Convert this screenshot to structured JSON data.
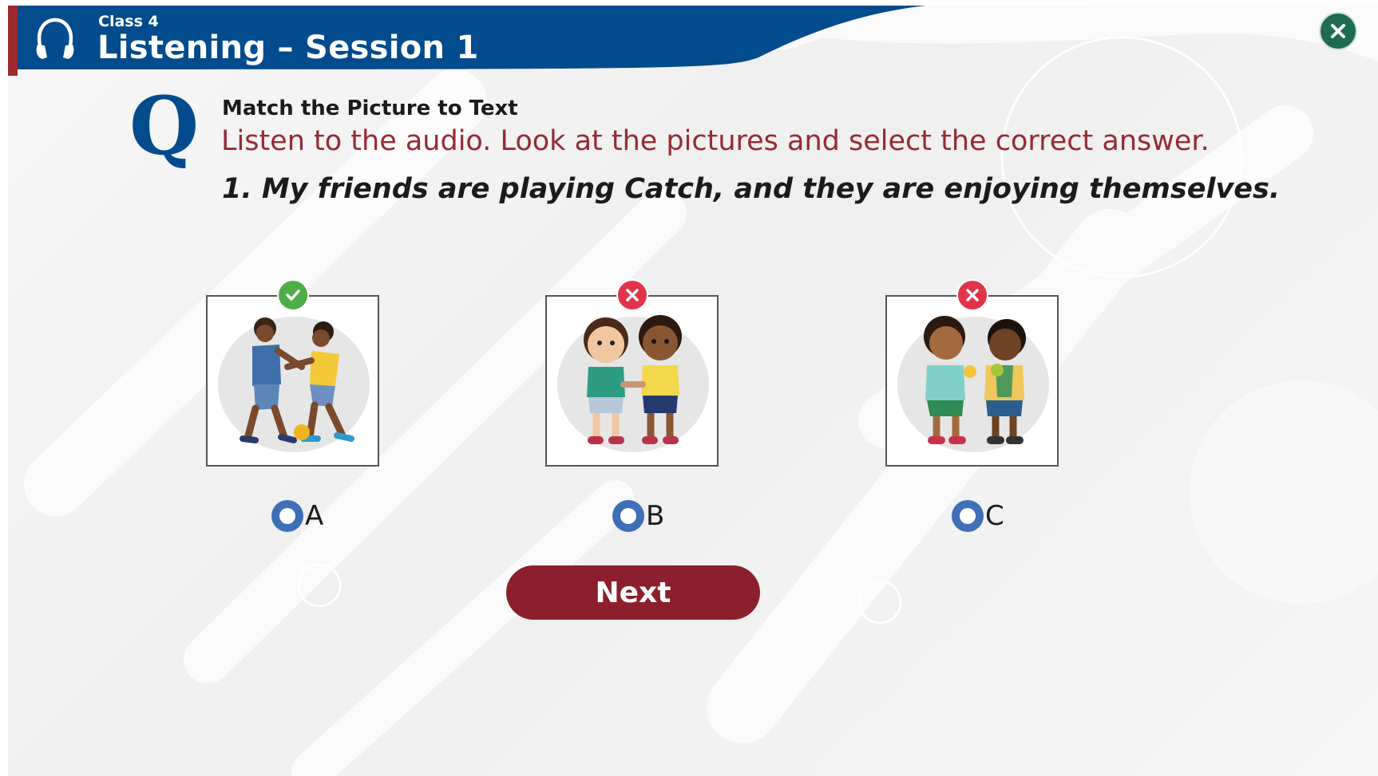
{
  "header": {
    "class_label": "Class 4",
    "session_title": "Listening – Session 1",
    "icon": "headphones-icon",
    "close_icon": "close-icon",
    "brand_color": "#024b8c",
    "accent_color": "#9c2a2f"
  },
  "question": {
    "mark": "Q",
    "heading": "Match the Picture to Text",
    "instruction": "Listen to the audio. Look at the pictures and select the correct answer.",
    "sentence": "1. My friends are playing Catch, and they are enjoying themselves."
  },
  "options": [
    {
      "label": "A",
      "picture": "two children playing catch with a yellow ball",
      "feedback": "correct",
      "feedback_icon": "check-icon"
    },
    {
      "label": "B",
      "picture": "two children holding hands",
      "feedback": "incorrect",
      "feedback_icon": "x-icon"
    },
    {
      "label": "C",
      "picture": "two children eating fruit",
      "feedback": "incorrect",
      "feedback_icon": "x-icon"
    }
  ],
  "actions": {
    "next_label": "Next"
  },
  "colors": {
    "correct": "#4dae48",
    "incorrect": "#e2334b",
    "radio": "#3f6fb6",
    "next_button": "#8b1f2b",
    "instruction_text": "#962a33"
  }
}
